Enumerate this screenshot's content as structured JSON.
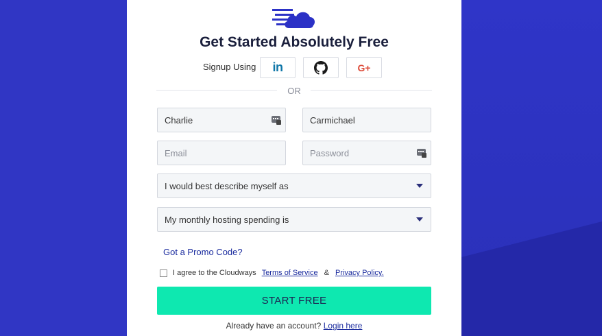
{
  "header": {
    "logo_icon": "cloudways-cloud-logo-icon",
    "title": "Get Started Absolutely Free"
  },
  "social": {
    "label": "Signup Using",
    "buttons": [
      {
        "name": "linkedin",
        "icon": "linkedin-icon",
        "glyph": "in"
      },
      {
        "name": "github",
        "icon": "github-icon"
      },
      {
        "name": "google-plus",
        "icon": "google-plus-icon",
        "glyph": "G+"
      }
    ]
  },
  "divider": {
    "text": "OR"
  },
  "form": {
    "first_name": {
      "value": "Charlie",
      "placeholder": ""
    },
    "last_name": {
      "value": "Carmichael",
      "placeholder": ""
    },
    "email": {
      "value": "",
      "placeholder": "Email"
    },
    "password": {
      "value": "",
      "placeholder": "Password"
    },
    "describe_select": {
      "selected": "I would best describe myself as"
    },
    "spending_select": {
      "selected": "My monthly hosting spending is"
    },
    "promo_link": "Got a Promo Code?",
    "agree": {
      "text": "I agree to the Cloudways",
      "terms": "Terms of Service",
      "amp": "&",
      "privacy": "Privacy Policy."
    },
    "submit_label": "START FREE"
  },
  "footer": {
    "text": "Already have an account?",
    "login_link": "Login here"
  },
  "colors": {
    "background": "#3036c4",
    "accent_button": "#0ee8b0",
    "link": "#1a2b9e",
    "title": "#1a1f3c"
  }
}
